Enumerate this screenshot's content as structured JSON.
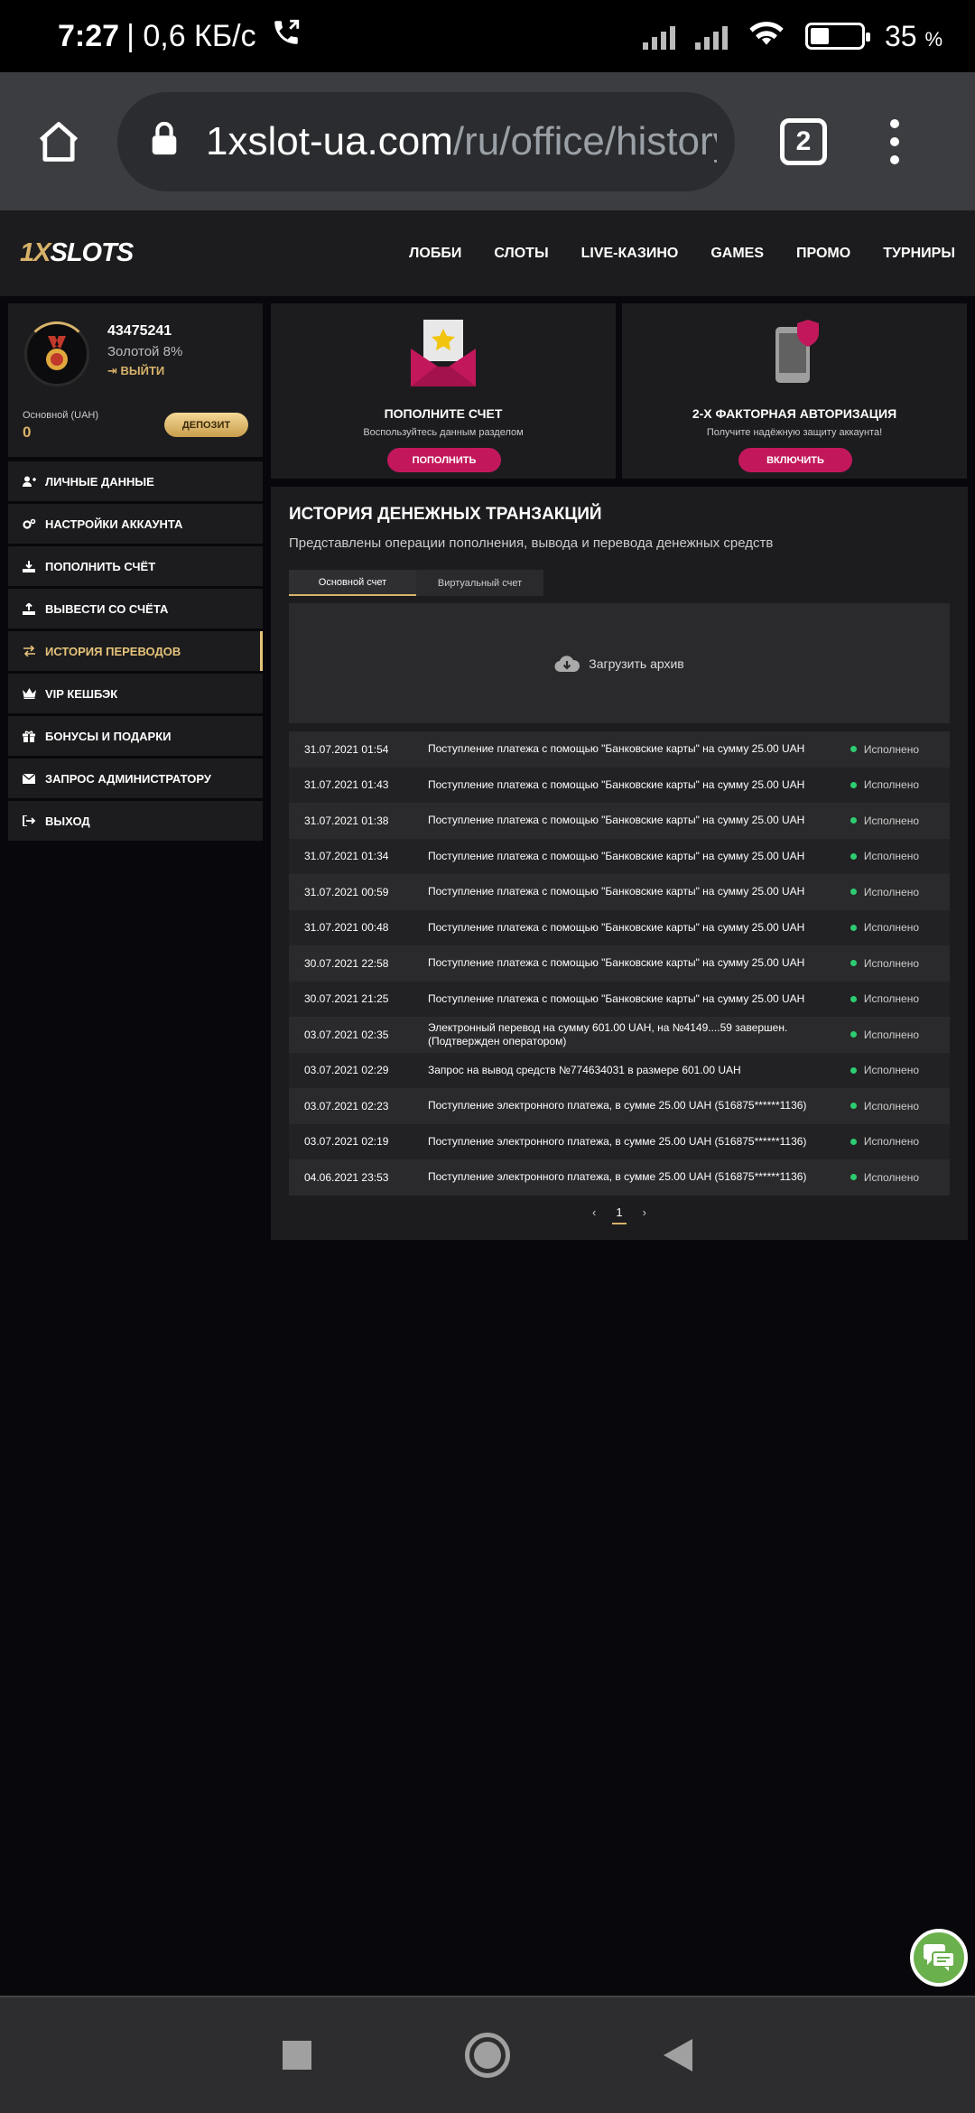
{
  "status_bar": {
    "time": "7:27",
    "speed": "| 0,6 КБ/с",
    "battery": "35",
    "battery_unit": "%",
    "battery_level": 0.35
  },
  "browser": {
    "url_host": "1xslot-ua.com",
    "url_path": "/ru/office/history",
    "tabs_count": "2"
  },
  "site": {
    "logo_a": "1X",
    "logo_b": "SLOTS",
    "nav": [
      "ЛОББИ",
      "СЛОТЫ",
      "LIVE-КАЗИНО",
      "GAMES",
      "ПРОМО",
      "ТУРНИРЫ"
    ]
  },
  "profile": {
    "user_id": "43475241",
    "rank": "Золотой 8%",
    "logout": "ВЫЙТИ",
    "balance_label": "Основной (UAH)",
    "balance": "0",
    "deposit_btn": "ДЕПОЗИТ"
  },
  "menu": [
    {
      "label": "ЛИЧНЫЕ ДАННЫЕ",
      "icon": "user-plus-icon"
    },
    {
      "label": "НАСТРОЙКИ АККАУНТА",
      "icon": "gears-icon"
    },
    {
      "label": "ПОПОЛНИТЬ СЧЁТ",
      "icon": "download-icon"
    },
    {
      "label": "ВЫВЕСТИ СО СЧЁТА",
      "icon": "upload-icon"
    },
    {
      "label": "ИСТОРИЯ ПЕРЕВОДОВ",
      "icon": "exchange-icon",
      "active": true
    },
    {
      "label": "VIP КЕШБЭК",
      "icon": "crown-icon"
    },
    {
      "label": "БОНУСЫ И ПОДАРКИ",
      "icon": "gift-icon"
    },
    {
      "label": "ЗАПРОС АДМИНИСТРАТОРУ",
      "icon": "envelope-icon"
    },
    {
      "label": "ВЫХОД",
      "icon": "sign-out-icon"
    }
  ],
  "promos": [
    {
      "title": "ПОПОЛНИТЕ СЧЕТ",
      "subtitle": "Воспользуйтесь данным разделом",
      "button": "ПОПОЛНИТЬ",
      "icon": "envelope-star-icon"
    },
    {
      "title": "2-Х ФАКТОРНАЯ АВТОРИЗАЦИЯ",
      "subtitle": "Получите надёжную защиту аккаунта!",
      "button": "ВКЛЮЧИТЬ",
      "icon": "phone-shield-icon"
    }
  ],
  "history": {
    "title": "ИСТОРИЯ ДЕНЕЖНЫХ ТРАНЗАКЦИЙ",
    "subtitle": "Представлены операции пополнения, вывода и перевода денежных средств",
    "tabs": [
      "Основной счет",
      "Виртуальный счет"
    ],
    "archive": "Загрузить архив",
    "rows": [
      {
        "date": "31.07.2021 01:54",
        "desc": "Поступление платежа с помощью \"Банковские карты\" на сумму 25.00 UAH",
        "status": "Исполнено"
      },
      {
        "date": "31.07.2021 01:43",
        "desc": "Поступление платежа с помощью \"Банковские карты\" на сумму 25.00 UAH",
        "status": "Исполнено"
      },
      {
        "date": "31.07.2021 01:38",
        "desc": "Поступление платежа с помощью \"Банковские карты\" на сумму 25.00 UAH",
        "status": "Исполнено"
      },
      {
        "date": "31.07.2021 01:34",
        "desc": "Поступление платежа с помощью \"Банковские карты\" на сумму 25.00 UAH",
        "status": "Исполнено"
      },
      {
        "date": "31.07.2021 00:59",
        "desc": "Поступление платежа с помощью \"Банковские карты\" на сумму 25.00 UAH",
        "status": "Исполнено"
      },
      {
        "date": "31.07.2021 00:48",
        "desc": "Поступление платежа с помощью \"Банковские карты\" на сумму 25.00 UAH",
        "status": "Исполнено"
      },
      {
        "date": "30.07.2021 22:58",
        "desc": "Поступление платежа с помощью \"Банковские карты\" на сумму 25.00 UAH",
        "status": "Исполнено"
      },
      {
        "date": "30.07.2021 21:25",
        "desc": "Поступление платежа с помощью \"Банковские карты\" на сумму 25.00 UAH",
        "status": "Исполнено"
      },
      {
        "date": "03.07.2021 02:35",
        "desc": "Электронный перевод на сумму 601.00 UAH, на №4149....59 завершен. (Подтвержден оператором)",
        "status": "Исполнено"
      },
      {
        "date": "03.07.2021 02:29",
        "desc": "Запрос на вывод средств №774634031 в размере 601.00 UAH",
        "status": "Исполнено"
      },
      {
        "date": "03.07.2021 02:23",
        "desc": "Поступление электронного платежа, в сумме 25.00 UAH (516875******1136)",
        "status": "Исполнено"
      },
      {
        "date": "03.07.2021 02:19",
        "desc": "Поступление электронного платежа, в сумме 25.00 UAH (516875******1136)",
        "status": "Исполнено"
      },
      {
        "date": "04.06.2021 23:53",
        "desc": "Поступление электронного платежа, в сумме 25.00 UAH (516875******1136)",
        "status": "Исполнено"
      }
    ],
    "pager": {
      "prev": "‹",
      "current": "1",
      "next": "›"
    }
  },
  "colors": {
    "accent": "#d8b26a",
    "button": "#c2185b",
    "status_ok": "#2ecc71",
    "chat": "#6ab04c"
  }
}
